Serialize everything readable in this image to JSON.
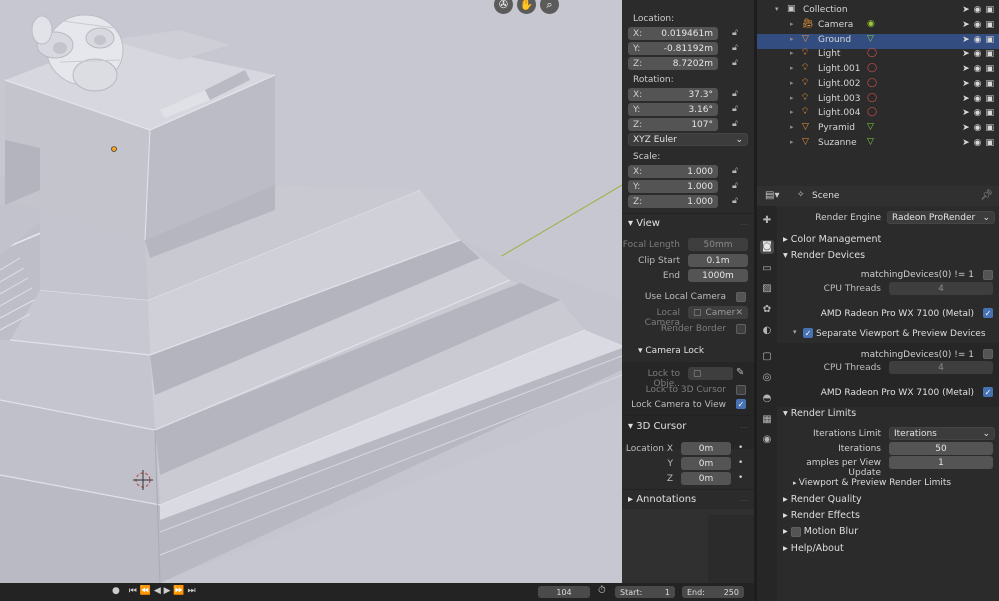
{
  "viewport": {
    "nav_icons": [
      "camera-view-icon",
      "hand-pan-icon",
      "zoom-icon"
    ]
  },
  "npanel": {
    "location_label": "Location:",
    "location": [
      {
        "k": "X:",
        "v": "0.019461m"
      },
      {
        "k": "Y:",
        "v": "-0.81192m"
      },
      {
        "k": "Z:",
        "v": "8.7202m"
      }
    ],
    "rotation_label": "Rotation:",
    "rotation": [
      {
        "k": "X:",
        "v": "37.3°"
      },
      {
        "k": "Y:",
        "v": "3.16°"
      },
      {
        "k": "Z:",
        "v": "107°"
      }
    ],
    "rotation_mode": "XYZ Euler",
    "scale_label": "Scale:",
    "scale": [
      {
        "k": "X:",
        "v": "1.000"
      },
      {
        "k": "Y:",
        "v": "1.000"
      },
      {
        "k": "Z:",
        "v": "1.000"
      }
    ],
    "view_header": "View",
    "focal_length_label": "Focal Length",
    "focal_length_value": "50mm",
    "clip_start_label": "Clip Start",
    "clip_start_value": "0.1m",
    "clip_end_label": "End",
    "clip_end_value": "1000m",
    "use_local_camera_label": "Use Local Camera",
    "local_camera_label": "Local Camera",
    "local_camera_value": "Camer",
    "render_border_label": "Render Border",
    "camera_lock_header": "Camera Lock",
    "lock_to_object_label": "Lock to Obje..",
    "lock_to_cursor_label": "Lock to 3D Cursor",
    "lock_camera_to_view_label": "Lock Camera to View",
    "cursor_header": "3D Cursor",
    "cursor_location_x_label": "Location X",
    "cursor_y_label": "Y",
    "cursor_z_label": "Z",
    "cursor_x_value": "0m",
    "cursor_y_value": "0m",
    "cursor_z_value": "0m",
    "annotations_header": "Annotations"
  },
  "outliner": {
    "collection_label": "Collection",
    "items": [
      {
        "name": "Camera",
        "selected": false
      },
      {
        "name": "Ground",
        "selected": true
      },
      {
        "name": "Light",
        "selected": false
      },
      {
        "name": "Light.001",
        "selected": false
      },
      {
        "name": "Light.002",
        "selected": false
      },
      {
        "name": "Light.003",
        "selected": false
      },
      {
        "name": "Light.004",
        "selected": false
      },
      {
        "name": "Pyramid",
        "selected": false
      },
      {
        "name": "Suzanne",
        "selected": false
      }
    ]
  },
  "properties": {
    "context_label": "Scene",
    "render_engine_label": "Render Engine",
    "render_engine_value": "Radeon ProRender",
    "color_management": "Color Management",
    "render_devices": "Render Devices",
    "matching_devices_label": "matchingDevices(0) != 1",
    "cpu_threads_label": "CPU Threads",
    "cpu_threads_value": "4",
    "gpu_label": "AMD Radeon Pro WX 7100 (Metal)",
    "separate_viewport_label": "Separate Viewport & Preview Devices",
    "matching_devices_label_2": "matchingDevices(0) != 1",
    "cpu_threads_label_2": "CPU Threads",
    "cpu_threads_value_2": "4",
    "gpu_label_2": "AMD Radeon Pro WX 7100 (Metal)",
    "render_limits": "Render Limits",
    "iterations_limit_label": "Iterations Limit",
    "iterations_limit_value": "Iterations",
    "iterations_label": "Iterations",
    "iterations_value": "50",
    "samples_label": "amples per View Update",
    "samples_value": "1",
    "viewport_render_limits": "Viewport & Preview Render Limits",
    "render_quality": "Render Quality",
    "render_effects": "Render Effects",
    "motion_blur": "Motion Blur",
    "help_about": "Help/About"
  },
  "timeline": {
    "current_frame": "104",
    "start_label": "Start:",
    "start_value": "1",
    "end_label": "End:",
    "end_value": "250"
  },
  "colors": {
    "selected_row": "#334d80",
    "checkbox_on": "#4772b3",
    "viewport_bg": "#c9cad3"
  }
}
